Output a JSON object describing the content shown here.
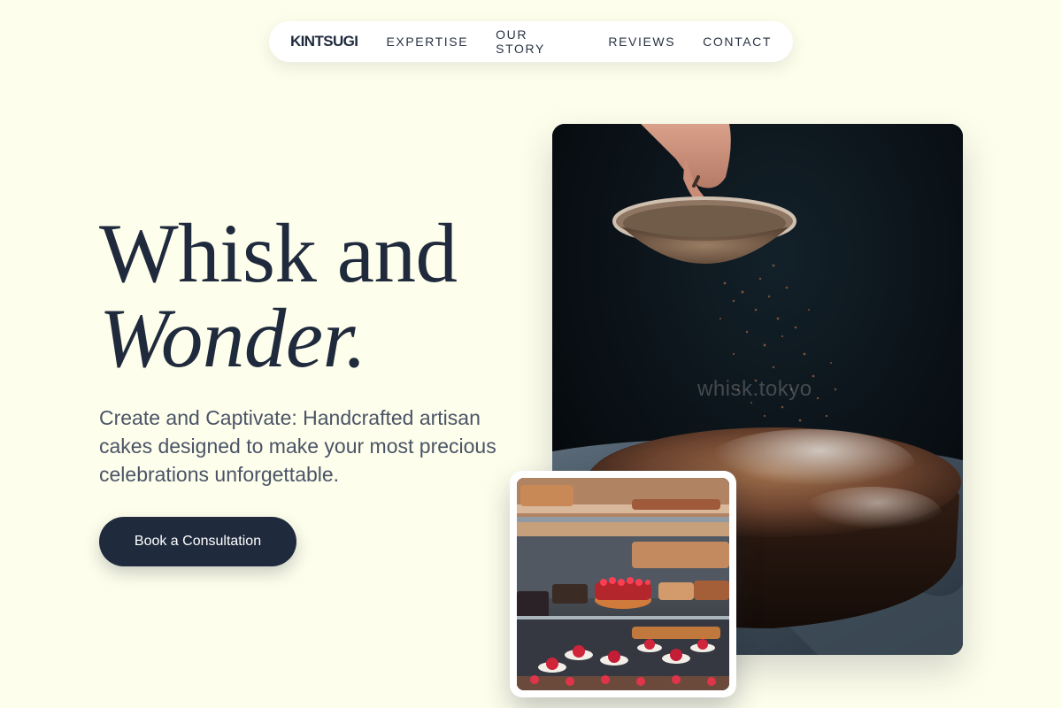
{
  "nav": {
    "brand": "KINTSUGI",
    "links": [
      "EXPERTISE",
      "OUR STORY",
      "REVIEWS",
      "CONTACT"
    ]
  },
  "hero": {
    "headline_line1": "Whisk and",
    "headline_line2": "Wonder.",
    "subtitle": "Create and Captivate: Handcrafted artisan cakes designed to make your most precious celebrations unforgettable.",
    "cta_label": "Book a Consultation"
  },
  "images": {
    "main_alt": "Cocoa powder being sifted over a chocolate cake",
    "main_watermark": "whisk.tokyo",
    "secondary_alt": "Bakery display case with fruit tarts and pastries"
  },
  "colors": {
    "background": "#fefeec",
    "navy": "#1f2a3d",
    "subtitle": "#4a5466",
    "nav_bg": "#ffffff"
  }
}
